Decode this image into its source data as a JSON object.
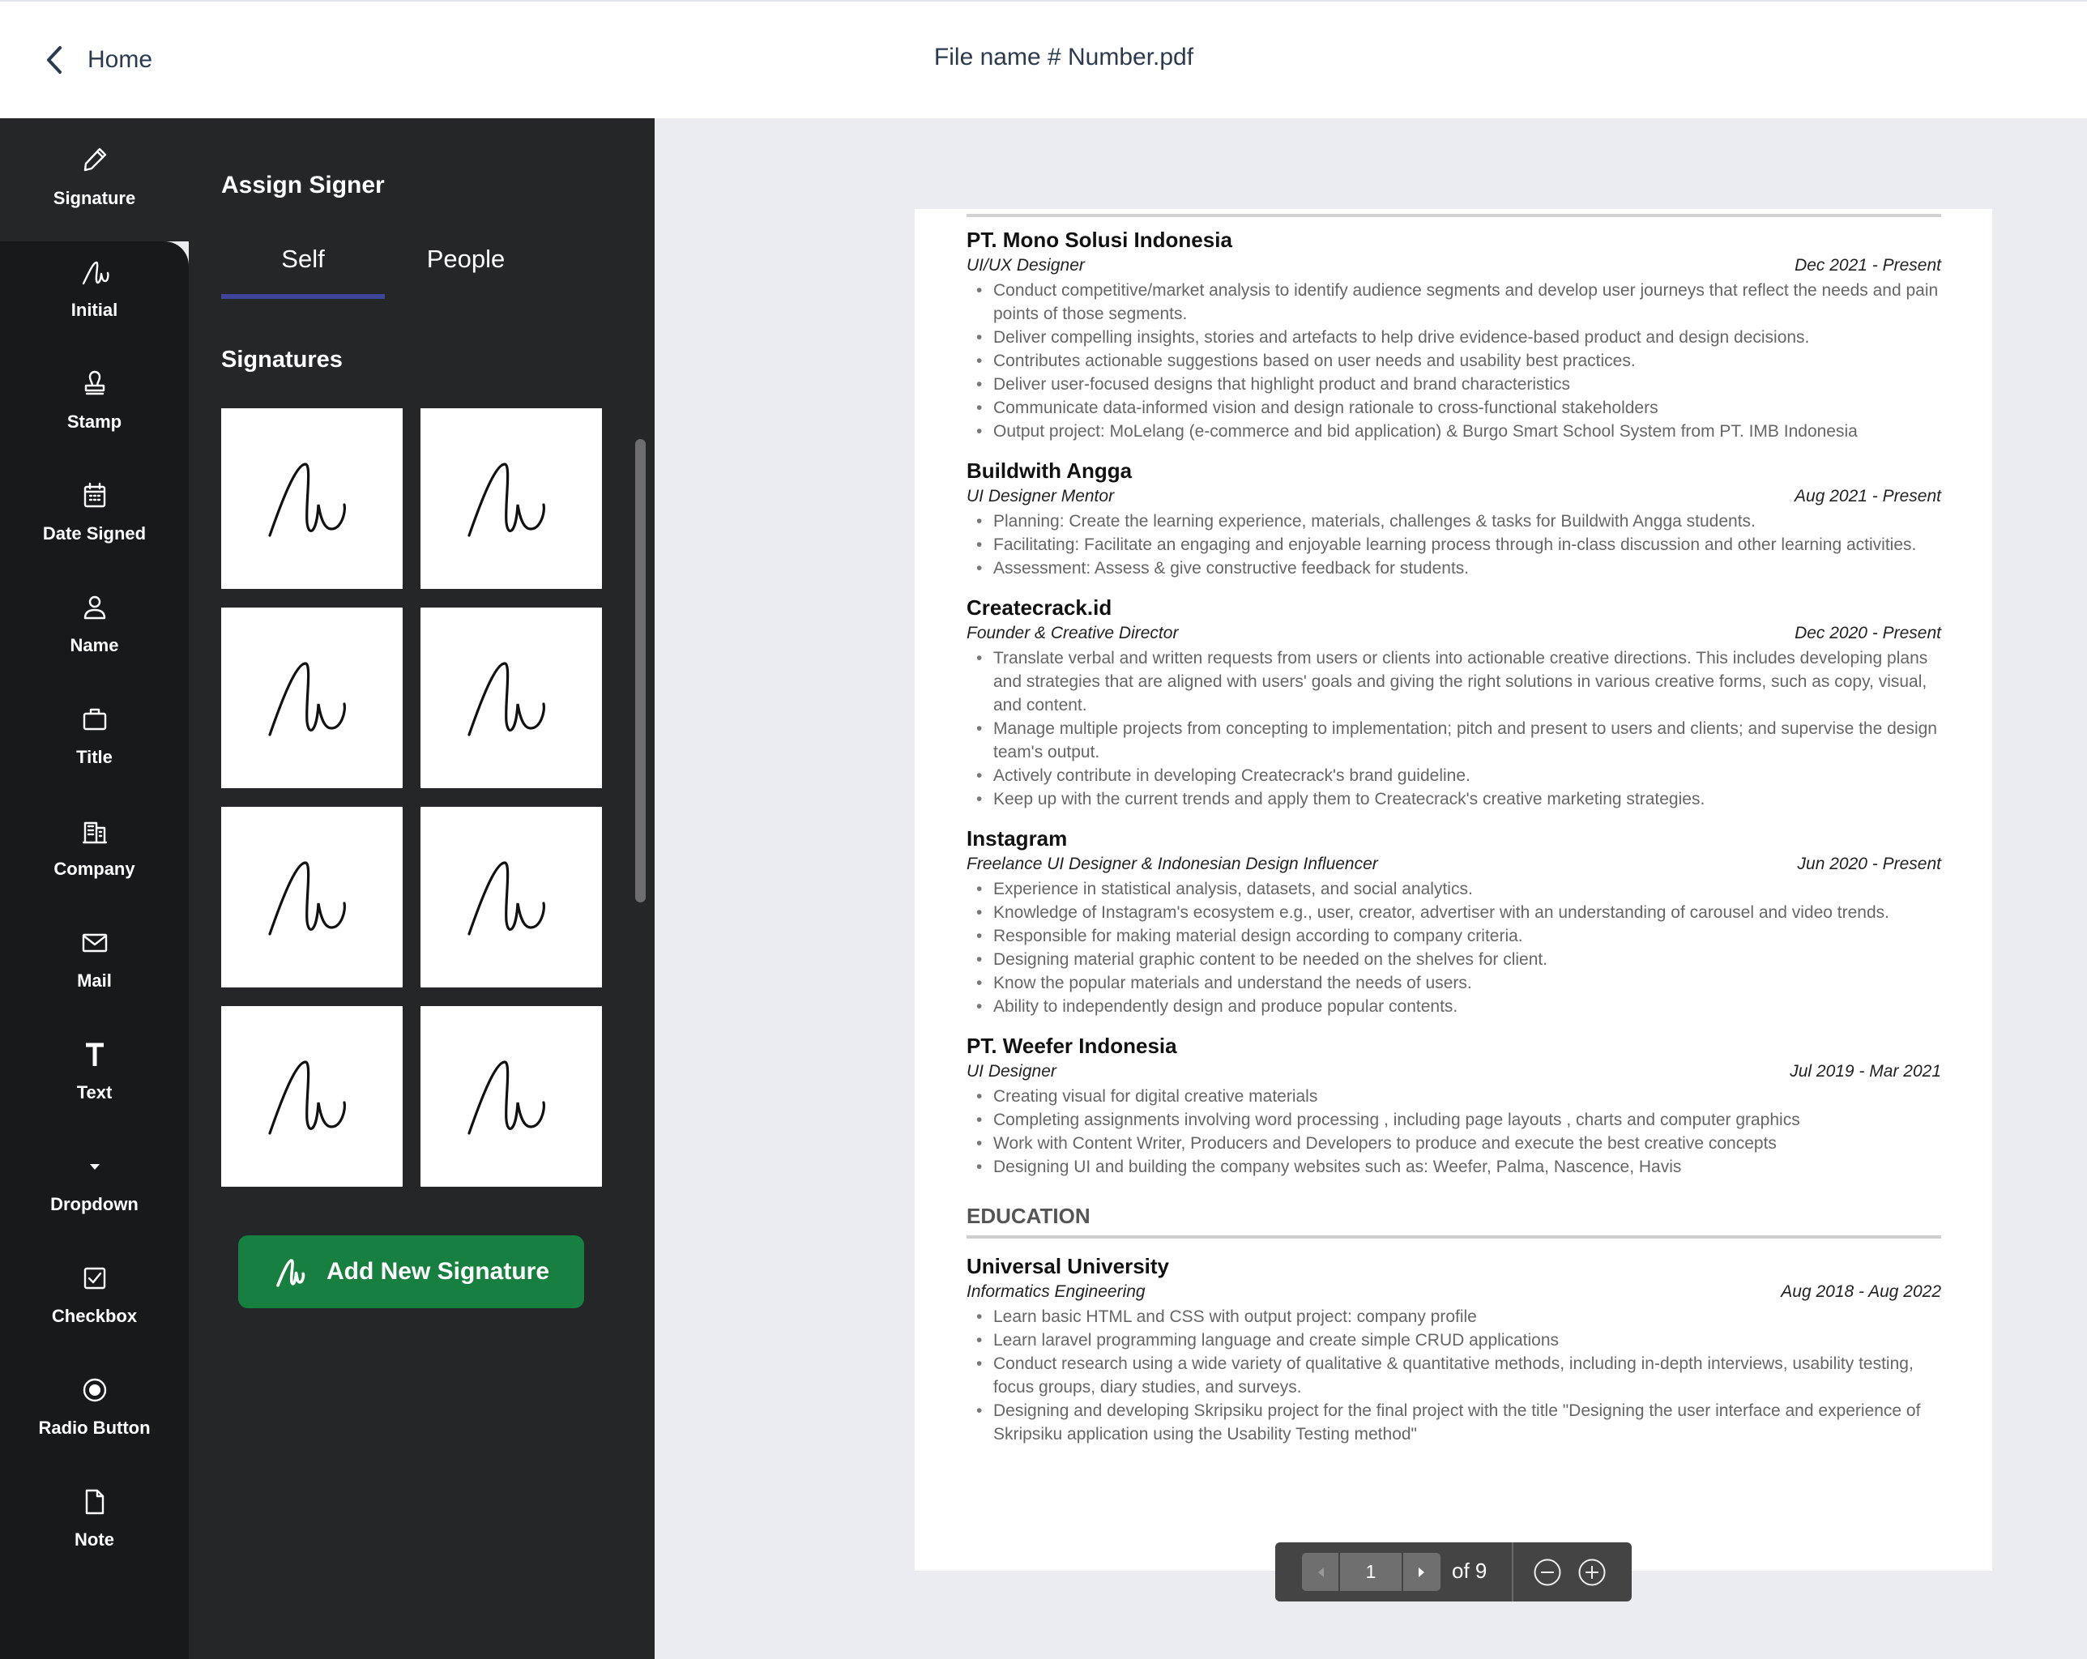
{
  "header": {
    "back_label": "Home",
    "file_title": "File name # Number.pdf"
  },
  "rail": {
    "items": [
      {
        "label": "Signature",
        "icon": "pen-icon",
        "active": true
      },
      {
        "label": "Initial",
        "icon": "initial-icon"
      },
      {
        "label": "Stamp",
        "icon": "stamp-icon"
      },
      {
        "label": "Date Signed",
        "icon": "calendar-icon"
      },
      {
        "label": "Name",
        "icon": "user-icon"
      },
      {
        "label": "Title",
        "icon": "briefcase-icon"
      },
      {
        "label": "Company",
        "icon": "building-icon"
      },
      {
        "label": "Mail",
        "icon": "mail-icon"
      },
      {
        "label": "Text",
        "icon": "text-icon"
      },
      {
        "label": "Dropdown",
        "icon": "caret-down-icon"
      },
      {
        "label": "Checkbox",
        "icon": "checkbox-icon"
      },
      {
        "label": "Radio Button",
        "icon": "radio-icon"
      },
      {
        "label": "Note",
        "icon": "file-icon"
      }
    ]
  },
  "panel": {
    "title": "Assign Signer",
    "tabs": [
      {
        "label": "Self",
        "active": true
      },
      {
        "label": "People"
      }
    ],
    "section_title": "Signatures",
    "signature_count": 8,
    "add_button": "Add New Signature",
    "accent": "#3f4699",
    "button_color": "#178040"
  },
  "document": {
    "jobs": [
      {
        "company": "PT. Mono Solusi Indonesia",
        "role": "UI/UX Designer",
        "dates": "Dec 2021 - Present",
        "bullets": [
          "Conduct competitive/market analysis to identify audience segments and develop user journeys that reflect the needs and pain points of those segments.",
          "Deliver compelling insights, stories and artefacts to help drive evidence-based product and design decisions.",
          "Contributes actionable suggestions based on user needs and usability best practices.",
          "Deliver user-focused designs that highlight product and brand characteristics",
          "Communicate data-informed vision and design rationale to cross-functional stakeholders",
          "Output project: MoLelang (e-commerce and bid application) & Burgo Smart School System from PT. IMB Indonesia"
        ]
      },
      {
        "company": "Buildwith Angga",
        "role": "UI Designer Mentor",
        "dates": "Aug 2021 - Present",
        "bullets": [
          "Planning: Create the learning experience, materials, challenges & tasks for Buildwith Angga students.",
          "Facilitating: Facilitate an engaging and enjoyable learning process through in-class discussion and other learning activities.",
          "Assessment: Assess & give constructive feedback for students."
        ]
      },
      {
        "company": "Createcrack.id",
        "role": "Founder & Creative Director",
        "dates": "Dec 2020 - Present",
        "bullets": [
          "Translate verbal and written requests from users or clients into actionable creative directions. This includes developing plans and strategies that are aligned with users' goals and giving the right solutions in various creative forms, such as copy, visual, and content.",
          "Manage multiple projects from concepting to implementation; pitch and present to users and clients; and supervise the design team's output.",
          "Actively contribute in developing Createcrack's brand guideline.",
          "Keep up with the current trends and apply them to Createcrack's creative marketing strategies."
        ]
      },
      {
        "company": "Instagram",
        "role": "Freelance UI Designer & Indonesian Design Influencer",
        "dates": "Jun 2020 - Present",
        "bullets": [
          "Experience in statistical analysis, datasets, and social analytics.",
          "Knowledge of Instagram's ecosystem e.g., user, creator, advertiser with an understanding of carousel and video trends.",
          "Responsible for making material design according to company criteria.",
          "Designing material graphic content to be needed on the shelves for client.",
          "Know the popular materials and understand the needs of users.",
          "Ability to independently design and produce popular contents."
        ]
      },
      {
        "company": "PT. Weefer Indonesia",
        "role": "UI Designer",
        "dates": "Jul 2019 - Mar 2021",
        "bullets": [
          "Creating visual for digital creative materials",
          "Completing assignments involving word processing , including page layouts , charts and computer graphics",
          "Work with Content Writer, Producers and Developers to produce and execute the best creative concepts",
          "Designing UI and building the company websites such as: Weefer, Palma, Nascence, Havis"
        ]
      }
    ],
    "education_heading": "EDUCATION",
    "education": [
      {
        "company": "Universal University",
        "role": "Informatics Engineering",
        "dates": "Aug 2018 - Aug 2022",
        "bullets": [
          "Learn basic HTML and CSS with output project: company profile",
          "Learn laravel programming language and create simple CRUD applications",
          "Conduct research using a wide variety of qualitative & quantitative methods, including in-depth interviews, usability testing, focus groups, diary studies, and surveys.",
          "Designing and developing Skripsiku project for the final project with the title \"Designing the user interface and experience of Skripsiku application using the Usability Testing method\""
        ]
      }
    ]
  },
  "pager": {
    "current_page": "1",
    "total_label": "of 9"
  }
}
